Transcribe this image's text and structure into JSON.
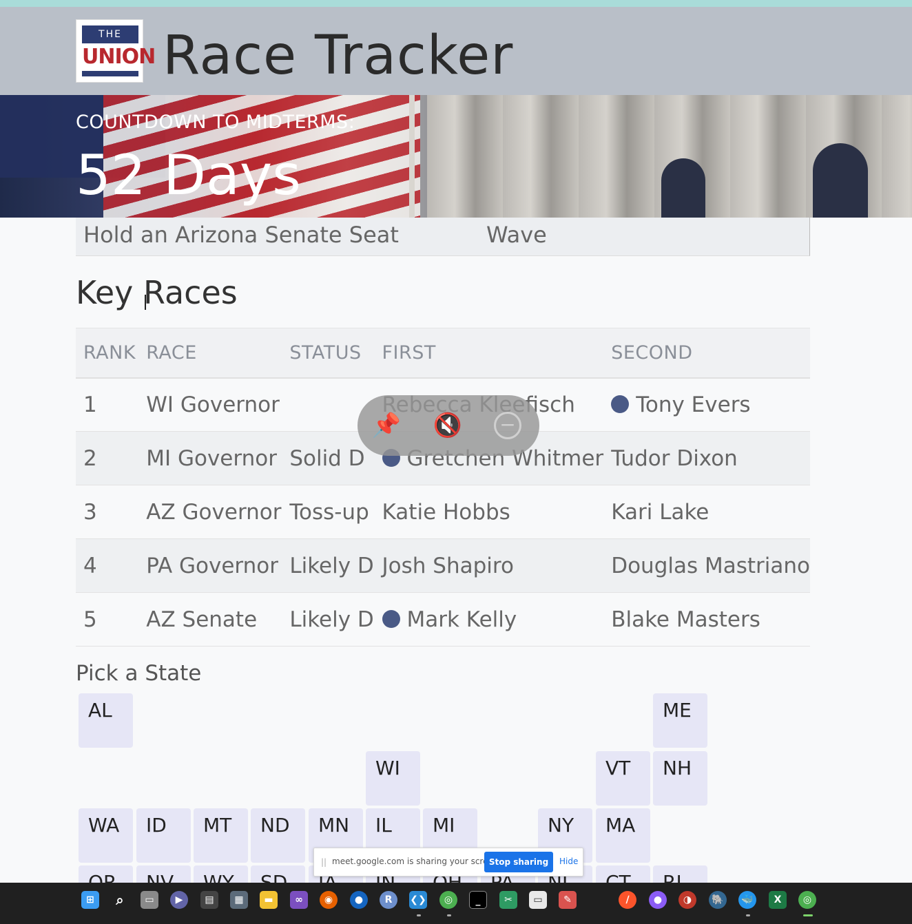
{
  "header": {
    "logo": {
      "top_text": "THE",
      "word": "UNION"
    },
    "title": "Race Tracker"
  },
  "hero": {
    "countdown_label": "COUNTDOWN TO MIDTERMS:",
    "countdown_value": "52 Days"
  },
  "prev_row": {
    "col1": "Hold an Arizona Senate Seat",
    "col2": "Wave"
  },
  "key_races": {
    "title": "Key Races",
    "columns": [
      "RANK",
      "RACE",
      "STATUS",
      "FIRST",
      "SECOND"
    ],
    "rows": [
      {
        "rank": "1",
        "race": "WI Governor",
        "status": "",
        "first": "Rebecca Kleefisch",
        "second": "Tony Evers"
      },
      {
        "rank": "2",
        "race": "MI Governor",
        "status": "Solid D",
        "first": "Gretchen Whitmer",
        "second": "Tudor Dixon"
      },
      {
        "rank": "3",
        "race": "AZ Governor",
        "status": "Toss-up",
        "first": "Katie Hobbs",
        "second": "Kari Lake"
      },
      {
        "rank": "4",
        "race": "PA Governor",
        "status": "Likely D",
        "first": "Josh Shapiro",
        "second": "Douglas Mastriano"
      },
      {
        "rank": "5",
        "race": "AZ Senate",
        "status": "Likely D",
        "first": "Mark Kelly",
        "second": "Blake Masters"
      }
    ]
  },
  "overlay": {
    "pin": "📌",
    "mute": "🔇",
    "minimize": "−"
  },
  "pick_state": {
    "title": "Pick a State",
    "tiles": [
      "AL",
      "ME",
      "WI",
      "VT",
      "NH",
      "WA",
      "ID",
      "MT",
      "ND",
      "MN",
      "IL",
      "MI",
      "NY",
      "MA",
      "OR",
      "NV",
      "WY",
      "SD",
      "IA",
      "IN",
      "OH",
      "PA",
      "NJ",
      "CT",
      "RI"
    ]
  },
  "share_bar": {
    "message": "meet.google.com is sharing your screen.",
    "stop": "Stop sharing",
    "hide": "Hide"
  },
  "taskbar": {
    "icons": [
      "windows-start",
      "search",
      "task-view",
      "teams",
      "widgets",
      "calculator",
      "file-explorer",
      "visual-studio",
      "firefox",
      "maps",
      "r-studio",
      "vscode",
      "chrome",
      "terminal",
      "snipping-tool",
      "remote-desktop",
      "paint",
      "brave",
      "github",
      "app",
      "postgres",
      "docker",
      "excel",
      "chrome-profile"
    ],
    "colors": {
      "windows-start": "#3b9cf2",
      "excel": "#1d7a45",
      "vscode": "#2a8ad4",
      "firefox": "#e66000",
      "chrome": "#4caf50"
    }
  }
}
